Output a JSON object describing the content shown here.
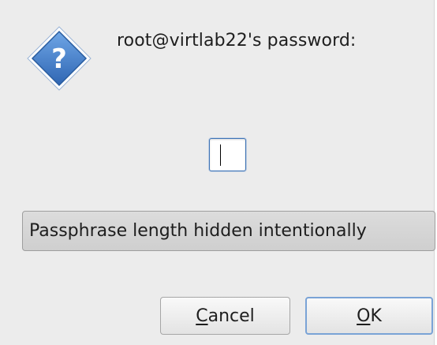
{
  "dialog": {
    "icon": "question-icon",
    "icon_glyph": "?",
    "prompt": "root@virtlab22's password:",
    "password_value": "",
    "info_text": "Passphrase length hidden intentionally",
    "cancel_mnemonic": "C",
    "cancel_rest": "ancel",
    "ok_mnemonic": "O",
    "ok_rest": "K"
  },
  "colors": {
    "dialog_background": "#ececec",
    "icon_fill": "#3d78c4",
    "focus_border": "#3e74b6"
  }
}
